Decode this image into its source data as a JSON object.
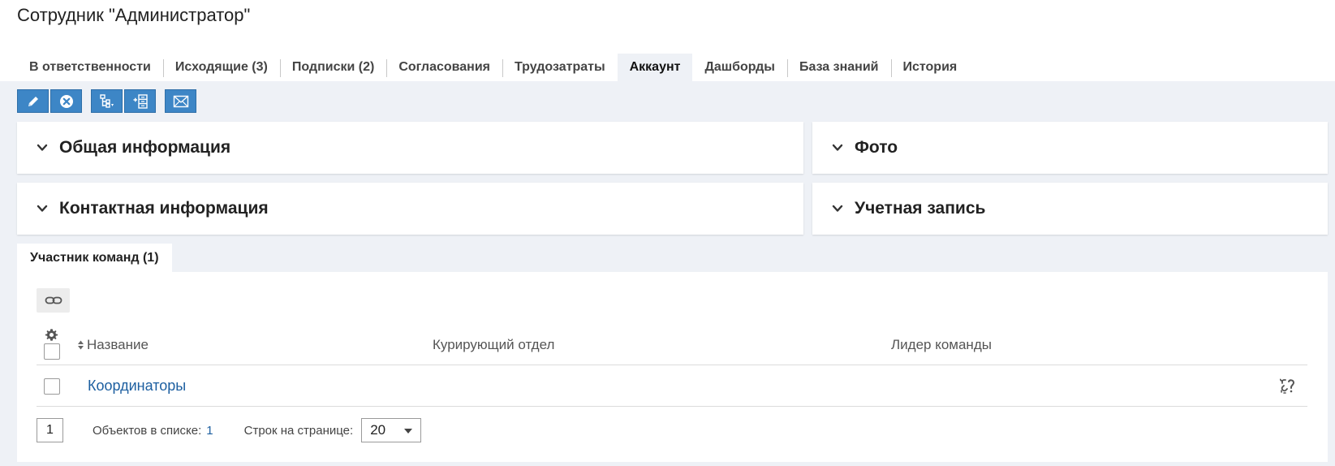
{
  "page": {
    "title": "Сотрудник \"Администратор\""
  },
  "tabs": [
    {
      "label": "В ответственности",
      "active": false
    },
    {
      "label": "Исходящие (3)",
      "active": false
    },
    {
      "label": "Подписки (2)",
      "active": false
    },
    {
      "label": "Согласования",
      "active": false
    },
    {
      "label": "Трудозатраты",
      "active": false
    },
    {
      "label": "Аккаунт",
      "active": true
    },
    {
      "label": "Дашборды",
      "active": false
    },
    {
      "label": "База знаний",
      "active": false
    },
    {
      "label": "История",
      "active": false
    }
  ],
  "toolbar": {
    "icons": [
      "pencil-icon",
      "cancel-icon",
      "hierarchy-icon",
      "add-to-list-icon",
      "mail-icon"
    ]
  },
  "panels": {
    "general": "Общая информация",
    "photo": "Фото",
    "contacts": "Контактная информация",
    "account": "Учетная запись"
  },
  "subtab": {
    "label": "Участник команд (1)"
  },
  "table": {
    "columns": {
      "name": "Название",
      "dept": "Курирующий отдел",
      "leader": "Лидер команды"
    },
    "rows": [
      {
        "name": "Координаторы",
        "dept": "",
        "leader": ""
      }
    ]
  },
  "pagination": {
    "page": "1",
    "count_label": "Объектов в списке:",
    "count_value": "1",
    "rows_label": "Строк на странице:",
    "rows_value": "20"
  },
  "colors": {
    "accent": "#3d86c6",
    "link": "#1d5fa0",
    "workspace_bg": "#eef1f6"
  }
}
